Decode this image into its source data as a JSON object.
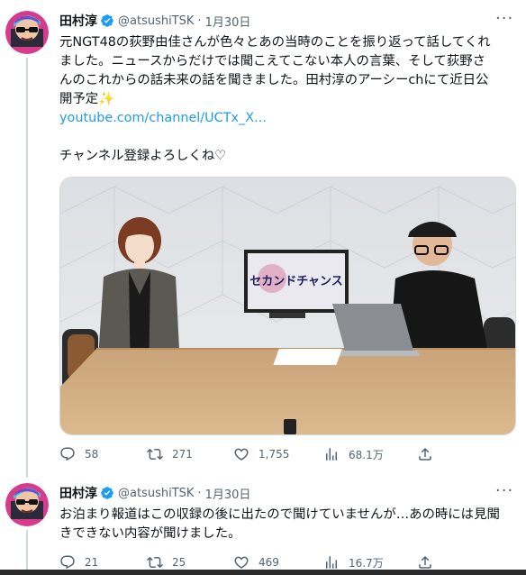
{
  "tweets": [
    {
      "author_name": "田村淳",
      "handle": "@atsushiTSK",
      "separator": "·",
      "date": "1月30日",
      "text_line1": "元NGT48の荻野由佳さんが色々とあの当時のことを振り返って話してくれ",
      "text_line2": "ました。ニュースからだけでは聞こえてこない本人の言葉、そして荻野さ",
      "text_line3": "んのこれからの話未来の話を聞きました。田村淳のアーシーchにて近日公",
      "text_line4": "開予定",
      "sparkle_emoji": "✨",
      "link": "youtube.com/channel/UCTx_X...",
      "text_line5": "チャンネル登録よろしくね♡",
      "media": {
        "monitor_text": "セカンドチャンス"
      },
      "stats": {
        "replies": "58",
        "retweets": "271",
        "likes": "1,755",
        "views": "68.1万"
      }
    },
    {
      "author_name": "田村淳",
      "handle": "@atsushiTSK",
      "separator": "·",
      "date": "1月30日",
      "text_line1": "お泊まり報道はこの収録の後に出たので聞けていませんが…あの時には見聞",
      "text_line2": "きできない内容が聞けました。",
      "stats": {
        "replies": "21",
        "retweets": "25",
        "likes": "469",
        "views": "16.7万"
      }
    }
  ],
  "colors": {
    "accent": "#1d9bf0",
    "muted": "#536471",
    "verified": "#1d9bf0"
  },
  "icons": [
    "reply-icon",
    "retweet-icon",
    "like-icon",
    "views-icon",
    "share-icon",
    "verified-icon",
    "more-icon"
  ]
}
